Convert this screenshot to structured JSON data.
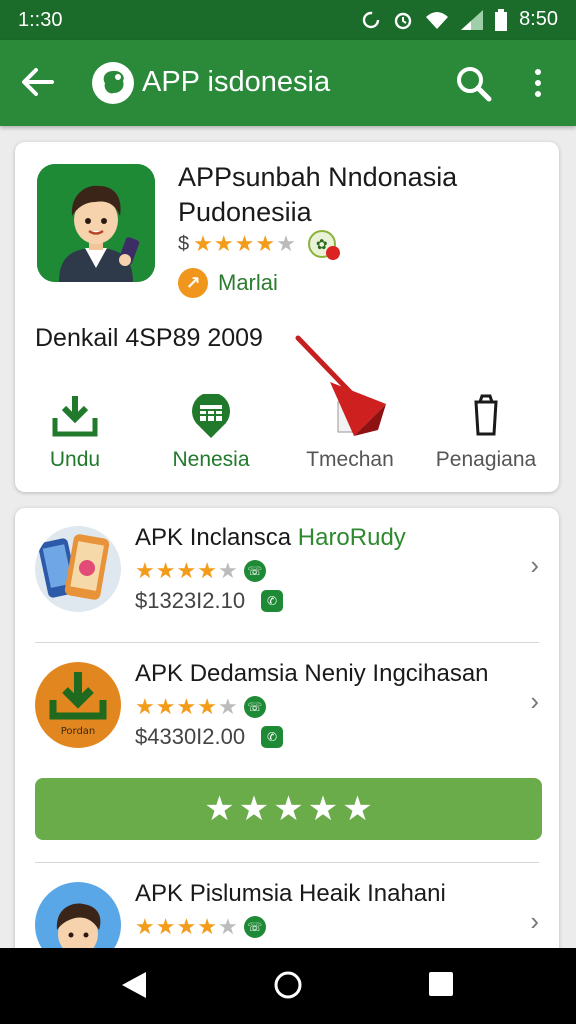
{
  "status": {
    "time_left": "1::30",
    "time_right": "8:50"
  },
  "app_bar": {
    "title": "APP isdonesia"
  },
  "detail": {
    "title": "APPsunbah Nndonasia Pudonesiia",
    "price_symbol": "$",
    "rating": 4,
    "developer": "Marlai",
    "meta": "Denkail 4SP89 2009",
    "actions": [
      {
        "label": "Undu"
      },
      {
        "label": "Nenesia"
      },
      {
        "label": "Tmechan"
      },
      {
        "label": "Penagiana"
      }
    ]
  },
  "list": [
    {
      "name": "APK Inclansca",
      "accent": " HaroRudy",
      "price": "$1323I2.10",
      "rating": 4
    },
    {
      "name": "APK Dedamsia Neniy Ingcihasan",
      "accent": "",
      "price": "$4330I2.00",
      "rating": 4,
      "thumb_label": "Pordan"
    },
    {
      "name": "APK Pislumsia Heaik Inahani",
      "accent": "",
      "price": "",
      "rating": 4
    }
  ],
  "rate_bar_stars": 5,
  "colors": {
    "primary": "#2a8a3a",
    "status_bar": "#1b6b2a",
    "star": "#f29c1a",
    "rate_bar": "#6aab4a"
  }
}
